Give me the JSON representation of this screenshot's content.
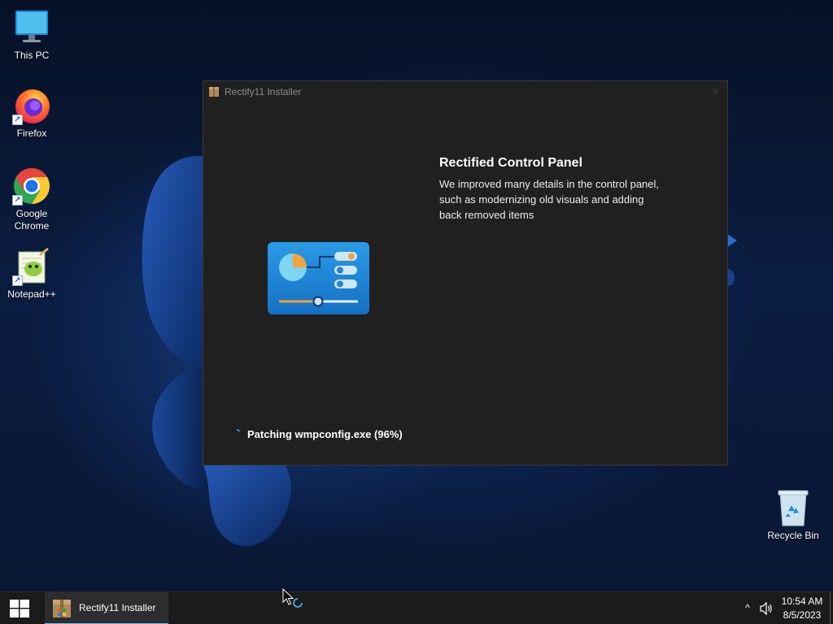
{
  "desktop": {
    "icons": [
      {
        "label": "This PC",
        "icon": "monitor-icon"
      },
      {
        "label": "Firefox",
        "icon": "firefox-icon",
        "shortcut": true
      },
      {
        "label": "Google Chrome",
        "icon": "chrome-icon",
        "shortcut": true
      },
      {
        "label": "Notepad++",
        "icon": "notepadpp-icon",
        "shortcut": true
      },
      {
        "label": "Recycle Bin",
        "icon": "recycle-bin-icon"
      }
    ]
  },
  "window": {
    "title": "Rectify11 Installer",
    "close_glyph": "✕",
    "feature_title": "Rectified Control Panel",
    "feature_description": "We improved many details in the control panel, such as modernizing old visuals and adding back removed items",
    "status_text": "Patching wmpconfig.exe (96%)",
    "progress_percent": 96
  },
  "taskbar": {
    "start_icon": "windows-logo-icon",
    "running_app_label": "Rectify11 Installer",
    "tray_chevron": "^",
    "clock_time": "10:54 AM",
    "clock_date": "8/5/2023"
  },
  "colors": {
    "window_bg": "#202020",
    "taskbar_bg": "#1b1b1b",
    "accent": "#76b9ed",
    "wallpaper_base": "#0a1a38"
  }
}
